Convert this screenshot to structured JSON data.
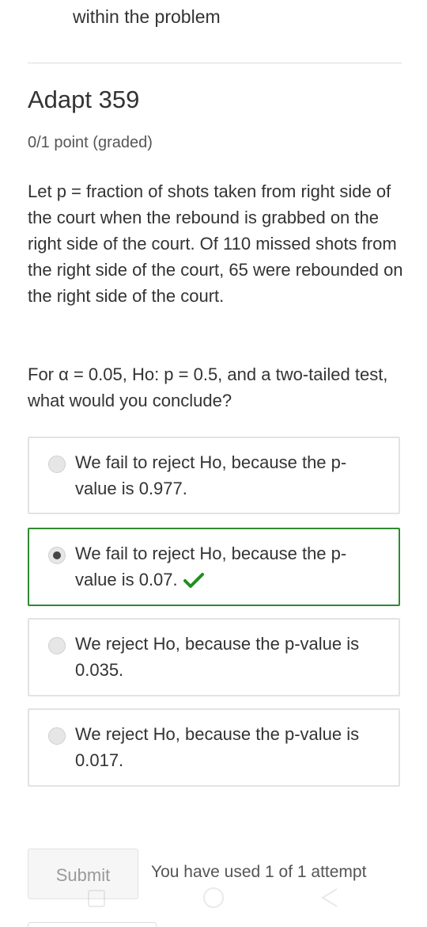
{
  "header": {
    "top_text": "within the problem"
  },
  "problem": {
    "title": "Adapt 359",
    "points": "0/1 point (graded)",
    "paragraph_1": "Let p = fraction of shots taken from right side of the court when the rebound is grabbed on the right side of the court. Of 110 missed shots from the right side of the court, 65 were rebounded on the right side of the court.",
    "paragraph_2": "For α = 0.05, Ho: p = 0.5, and a two-tailed test, what would you conclude?"
  },
  "choices": [
    {
      "label": "We fail to reject Ho, because the p-value is 0.977.",
      "selected": false,
      "correct": false
    },
    {
      "label": "We fail to reject Ho, because the p-value is 0.07.",
      "selected": true,
      "correct": true
    },
    {
      "label": "We reject Ho, because the p-value is 0.035.",
      "selected": false,
      "correct": false
    },
    {
      "label": "We reject Ho, because the p-value is 0.017.",
      "selected": false,
      "correct": false
    }
  ],
  "footer": {
    "submit_label": "Submit",
    "attempts_text": "You have used 1 of 1 attempt"
  },
  "colors": {
    "correct_border": "#2f8a2f",
    "check_mark": "#1e8f1e",
    "text": "#333333"
  },
  "icons": {
    "correct": "check-icon",
    "selected": "radio-selected-icon",
    "unselected": "radio-unselected-icon"
  }
}
